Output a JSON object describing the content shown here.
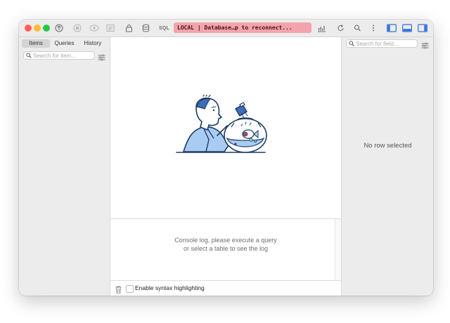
{
  "toolbar": {
    "sql_label": "SQL",
    "connection_status": "LOCAL | Database…p to reconnect...",
    "status_color": "#f2a3ab"
  },
  "sidebar": {
    "tabs": [
      {
        "label": "Items",
        "active": true
      },
      {
        "label": "Queries",
        "active": false
      },
      {
        "label": "History",
        "active": false
      }
    ],
    "search_placeholder": "Search for item...",
    "add_label": "+",
    "select_value": ""
  },
  "main": {
    "console_message_line1": "Console log, please execute a query",
    "console_message_line2": "or select a table to see the log",
    "syntax_highlight_label": "Enable syntax highlighting",
    "syntax_highlight_checked": false
  },
  "detail": {
    "search_placeholder": "Search for field...",
    "empty_message": "No row selected"
  },
  "icons": {
    "window_controls": [
      "close",
      "minimize",
      "zoom"
    ],
    "toolbar": [
      "connection-icon",
      "stop-icon",
      "preview-icon",
      "log-icon",
      "lock-icon",
      "database-icon",
      "chart-icon",
      "refresh-icon",
      "search-icon",
      "more-icon",
      "toggle-left-panel-icon",
      "toggle-bottom-panel-icon",
      "toggle-right-panel-icon"
    ]
  }
}
